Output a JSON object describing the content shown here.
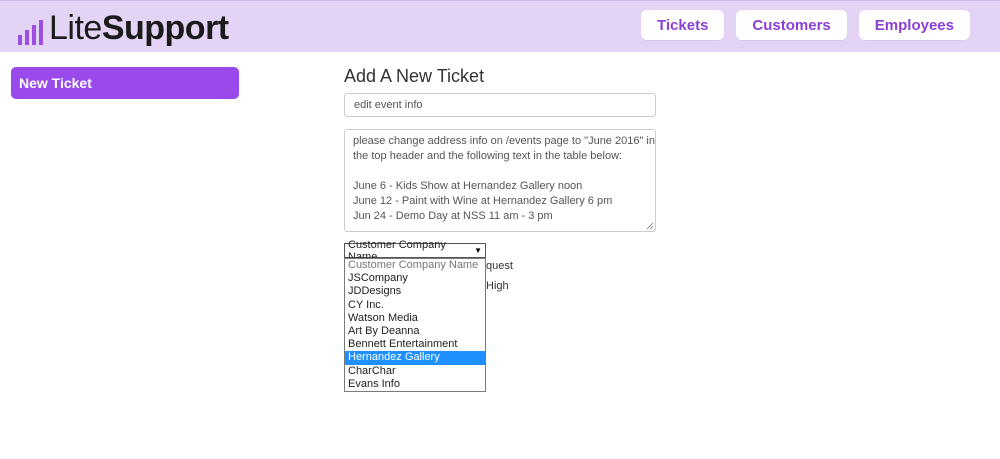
{
  "app": {
    "logo_lite": "Lite",
    "logo_support": "Support",
    "accent": "#9a49ea"
  },
  "nav": {
    "tickets": "Tickets",
    "customers": "Customers",
    "employees": "Employees"
  },
  "sidebar": {
    "new_ticket": "New Ticket"
  },
  "form": {
    "title": "Add A New Ticket",
    "subject_value": "edit event info",
    "description_lines": [
      "please change address info on /events page to \"June 2016\" in",
      "the top header and the following text in the table below:",
      "",
      "June 6 - Kids Show at Hernandez Gallery noon",
      "June 12 - Paint with Wine at Hernandez Gallery 6 pm",
      "Jun 24 - Demo Day at NSS 11 am - 3 pm"
    ],
    "company_select_value": "Customer Company Name",
    "obscured_type_text": "quest",
    "obscured_priority_text": "High",
    "company_options": [
      "Customer Company Name",
      "JSCompany",
      "JDDesigns",
      "CY Inc.",
      "Watson Media",
      "Art By Deanna",
      "Bennett Entertainment",
      "Hernandez Gallery",
      "CharChar",
      "Evans Info"
    ],
    "highlighted_option": "Hernandez Gallery"
  }
}
